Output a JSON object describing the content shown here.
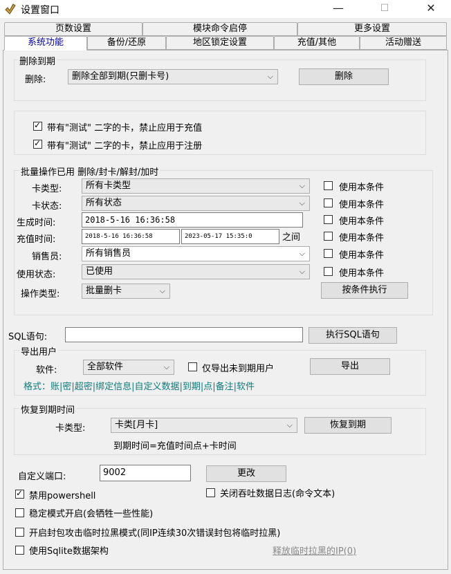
{
  "window": {
    "title": "设置窗口",
    "minimize": "—",
    "maximize": "☐",
    "close": "✕"
  },
  "tabs_back": [
    "页数设置",
    "模块命令启停",
    "更多设置"
  ],
  "tabs_front": [
    "系统功能",
    "备份/还原",
    "地区锁定设置",
    "充值/其他",
    "活动赠送"
  ],
  "delete_expired": {
    "group_label": "删除到期",
    "label": "删除:",
    "selected": "删除全部到期(只删卡号)",
    "button": "删除"
  },
  "test_cards": {
    "recharge_label": "带有\"测试\" 二字的卡，禁止应用于充值",
    "register_label": "带有\"测试\" 二字的卡，禁止应用于注册"
  },
  "batch": {
    "group_label": "批量操作已用  删除/封卡/解封/加时",
    "card_type_label": "卡类型:",
    "card_type_value": "所有卡类型",
    "card_status_label": "卡状态:",
    "card_status_value": "所有状态",
    "gen_time_label": "生成时间:",
    "gen_time_value": "2018-5-16 16:36:58",
    "recharge_time_label": "充值时间:",
    "recharge_from": "2018-5-16 16:36:58",
    "recharge_to": "2023-05-17 15:35:0",
    "between": "之间",
    "seller_label": "销售员:",
    "seller_value": "所有销售员",
    "use_status_label": "使用状态:",
    "use_status_value": "已使用",
    "op_type_label": "操作类型:",
    "op_type_value": "批量删卡",
    "use_condition": "使用本条件",
    "execute_button": "按条件执行"
  },
  "sql": {
    "label": "SQL语句:",
    "value": "",
    "button": "执行SQL语句"
  },
  "export": {
    "group_label": "导出用户",
    "software_label": "软件:",
    "software_value": "全部软件",
    "unexpired_only": "仅导出未到期用户",
    "button": "导出",
    "format": "格式：账|密|超密|绑定信息|自定义数据|到期|点|备注|软件"
  },
  "restore": {
    "group_label": "恢复到期时间",
    "card_type_label": "卡类型:",
    "card_type_value": "卡类[月卡]",
    "button": "恢复到期",
    "formula": "到期时间=充值时间点+卡时间"
  },
  "port": {
    "label": "自定义端口:",
    "value": "9002",
    "button": "更改"
  },
  "options": {
    "disable_powershell": "禁用powershell",
    "close_log": "关闭吞吐数据日志(命令文本)",
    "stable_mode": "稳定模式开启(会牺牲一些性能)",
    "flood_blacklist": "开启封包攻击临时拉黑模式(同IP连续30次错误封包将临时拉黑)",
    "use_sqlite": "使用Sqlite数据架构",
    "release_ip": "释放临时拉黑的IP(0)"
  }
}
